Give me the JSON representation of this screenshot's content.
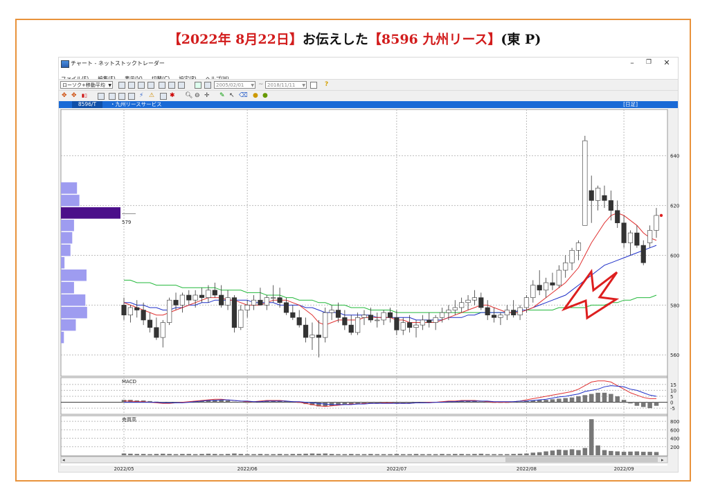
{
  "headline": {
    "date": "【2022年  8月22日】",
    "middle": "お伝えした",
    "stock": "【8596  九州リース】",
    "market": "(東 P)"
  },
  "window": {
    "title": "チャート - ネットストックトレーダー",
    "menu": [
      "ファイル(F)",
      "編集(E)",
      "表示(V)",
      "切替(C)",
      "設定(P)",
      "ヘルプ(H)"
    ],
    "chart_type_select": "ローソク+移動平均",
    "date_from": "2005/02/01",
    "date_to": "2018/11/11",
    "symbol_code": "8596/T",
    "symbol_name": "・九州リースサービス",
    "period": "[日足]",
    "colors": {
      "bluebar": "#1a6ad6",
      "frame": "#e8923a",
      "headline_red": "#d21c1c"
    }
  },
  "chart_data": {
    "type": "candlestick",
    "x_labels": [
      "2022/05",
      "2022/06",
      "2022/07",
      "2022/08",
      "2022/09"
    ],
    "price_axis": {
      "ticks": [
        560,
        580,
        600,
        620,
        640
      ],
      "ylim": [
        552,
        658
      ]
    },
    "volume_profile_label": "579",
    "candles": [
      [
        580,
        583,
        574,
        576
      ],
      [
        576,
        580,
        573,
        579
      ],
      [
        579,
        582,
        575,
        578
      ],
      [
        578,
        581,
        572,
        574
      ],
      [
        574,
        577,
        569,
        571
      ],
      [
        571,
        575,
        566,
        567
      ],
      [
        567,
        574,
        563,
        573
      ],
      [
        573,
        583,
        572,
        582
      ],
      [
        582,
        585,
        578,
        580
      ],
      [
        580,
        585,
        577,
        584
      ],
      [
        584,
        586,
        580,
        582
      ],
      [
        582,
        586,
        579,
        584
      ],
      [
        584,
        587,
        581,
        583
      ],
      [
        583,
        588,
        581,
        586
      ],
      [
        586,
        589,
        583,
        584
      ],
      [
        584,
        588,
        579,
        580
      ],
      [
        580,
        586,
        578,
        583
      ],
      [
        583,
        584,
        569,
        571
      ],
      [
        571,
        580,
        570,
        578
      ],
      [
        578,
        582,
        575,
        580
      ],
      [
        580,
        584,
        578,
        582
      ],
      [
        582,
        587,
        580,
        580
      ],
      [
        580,
        584,
        578,
        583
      ],
      [
        583,
        588,
        581,
        583
      ],
      [
        583,
        587,
        579,
        581
      ],
      [
        581,
        583,
        576,
        577
      ],
      [
        577,
        580,
        574,
        575
      ],
      [
        575,
        578,
        571,
        572
      ],
      [
        572,
        575,
        565,
        567
      ],
      [
        567,
        573,
        562,
        568
      ],
      [
        568,
        574,
        559,
        567
      ],
      [
        567,
        579,
        565,
        577
      ],
      [
        577,
        580,
        574,
        578
      ],
      [
        578,
        581,
        573,
        575
      ],
      [
        575,
        578,
        570,
        572
      ],
      [
        572,
        576,
        568,
        569
      ],
      [
        569,
        577,
        568,
        575
      ],
      [
        575,
        578,
        572,
        576
      ],
      [
        576,
        579,
        573,
        574
      ],
      [
        574,
        577,
        571,
        574
      ],
      [
        574,
        578,
        572,
        577
      ],
      [
        577,
        579,
        573,
        575
      ],
      [
        575,
        578,
        568,
        570
      ],
      [
        570,
        575,
        568,
        573
      ],
      [
        573,
        576,
        569,
        571
      ],
      [
        571,
        574,
        567,
        572
      ],
      [
        572,
        576,
        570,
        574
      ],
      [
        574,
        577,
        571,
        573
      ],
      [
        573,
        576,
        570,
        575
      ],
      [
        575,
        579,
        573,
        577
      ],
      [
        577,
        580,
        574,
        578
      ],
      [
        578,
        582,
        576,
        579
      ],
      [
        579,
        583,
        577,
        581
      ],
      [
        581,
        584,
        578,
        582
      ],
      [
        582,
        586,
        580,
        583
      ],
      [
        583,
        585,
        578,
        579
      ],
      [
        579,
        582,
        574,
        576
      ],
      [
        576,
        579,
        573,
        575
      ],
      [
        575,
        577,
        572,
        576
      ],
      [
        576,
        580,
        574,
        578
      ],
      [
        578,
        582,
        575,
        576
      ],
      [
        576,
        580,
        574,
        579
      ],
      [
        579,
        584,
        577,
        583
      ],
      [
        583,
        590,
        581,
        588
      ],
      [
        588,
        594,
        584,
        586
      ],
      [
        586,
        591,
        583,
        589
      ],
      [
        589,
        593,
        586,
        588
      ],
      [
        588,
        596,
        587,
        594
      ],
      [
        594,
        600,
        591,
        597
      ],
      [
        597,
        603,
        594,
        602
      ],
      [
        602,
        606,
        598,
        605
      ],
      [
        612,
        648,
        612,
        646
      ],
      [
        626,
        632,
        613,
        622
      ],
      [
        622,
        628,
        618,
        627
      ],
      [
        624,
        628,
        619,
        622
      ],
      [
        622,
        626,
        614,
        618
      ],
      [
        618,
        622,
        611,
        613
      ],
      [
        613,
        616,
        603,
        605
      ],
      [
        605,
        610,
        600,
        609
      ],
      [
        609,
        612,
        603,
        604
      ],
      [
        604,
        606,
        596,
        597
      ],
      [
        605,
        612,
        603,
        610
      ],
      [
        610,
        619,
        607,
        616
      ]
    ],
    "ma_short": [
      581,
      580,
      579,
      578,
      577,
      576,
      576,
      577,
      578,
      579,
      580,
      581,
      582,
      583,
      583,
      583,
      582,
      582,
      581,
      580,
      580,
      580,
      581,
      582,
      582,
      582,
      581,
      580,
      578,
      576,
      573,
      572,
      573,
      574,
      574,
      574,
      574,
      575,
      575,
      575,
      575,
      575,
      574,
      574,
      573,
      573,
      573,
      573,
      573,
      574,
      575,
      576,
      577,
      578,
      579,
      580,
      580,
      579,
      578,
      577,
      577,
      577,
      578,
      579,
      581,
      583,
      585,
      587,
      589,
      592,
      595,
      600,
      605,
      609,
      613,
      616,
      617,
      616,
      614,
      612,
      609,
      607,
      606
    ],
    "ma_mid": [
      581,
      581,
      580,
      580,
      579,
      579,
      578,
      578,
      579,
      579,
      580,
      580,
      581,
      581,
      582,
      582,
      582,
      582,
      582,
      582,
      581,
      581,
      581,
      581,
      580,
      580,
      580,
      580,
      579,
      579,
      578,
      577,
      577,
      577,
      576,
      576,
      576,
      576,
      576,
      575,
      575,
      575,
      575,
      575,
      575,
      574,
      574,
      574,
      574,
      574,
      575,
      575,
      575,
      576,
      576,
      577,
      577,
      577,
      577,
      577,
      577,
      578,
      578,
      579,
      580,
      581,
      582,
      583,
      584,
      586,
      588,
      590,
      592,
      594,
      596,
      597,
      598,
      599,
      600,
      601,
      602,
      603,
      604
    ],
    "ma_long": [
      590,
      590,
      589,
      589,
      589,
      588,
      588,
      588,
      588,
      587,
      587,
      587,
      587,
      587,
      587,
      586,
      586,
      586,
      586,
      585,
      585,
      585,
      584,
      584,
      584,
      583,
      583,
      582,
      582,
      582,
      581,
      581,
      580,
      580,
      580,
      579,
      579,
      579,
      578,
      578,
      578,
      578,
      577,
      577,
      577,
      577,
      577,
      577,
      577,
      577,
      577,
      577,
      577,
      577,
      577,
      577,
      577,
      577,
      577,
      577,
      577,
      578,
      578,
      578,
      578,
      578,
      578,
      579,
      579,
      579,
      579,
      579,
      580,
      580,
      580,
      581,
      581,
      582,
      582,
      583,
      583,
      583,
      584
    ],
    "volume_profile": [
      {
        "price": 627,
        "value": 0.27
      },
      {
        "price": 622,
        "value": 0.31
      },
      {
        "price": 617,
        "value": 1.0
      },
      {
        "price": 612,
        "value": 0.22
      },
      {
        "price": 607,
        "value": 0.19
      },
      {
        "price": 602,
        "value": 0.16
      },
      {
        "price": 597,
        "value": 0.06
      },
      {
        "price": 592,
        "value": 0.43
      },
      {
        "price": 587,
        "value": 0.22
      },
      {
        "price": 582,
        "value": 0.41
      },
      {
        "price": 577,
        "value": 0.44
      },
      {
        "price": 572,
        "value": 0.25
      },
      {
        "price": 567,
        "value": 0.05
      }
    ],
    "macd": {
      "label": "MACD",
      "ticks": [
        15,
        10,
        5,
        0,
        -5
      ],
      "ylim": [
        -9,
        19
      ],
      "histogram": [
        2,
        2,
        1.5,
        1.5,
        1,
        0.5,
        -0.5,
        -1,
        -0.5,
        0,
        0.5,
        1,
        1.5,
        2,
        2,
        2,
        1.5,
        0.5,
        0,
        -0.5,
        0,
        0.5,
        1,
        1.5,
        1.5,
        1,
        0.5,
        -0.5,
        -1.5,
        -2.5,
        -3.5,
        -3.5,
        -3,
        -2.5,
        -2,
        -1.5,
        -1.5,
        -1,
        -1,
        -1,
        -0.5,
        -0.5,
        -1,
        -1,
        -1,
        -0.5,
        -0.5,
        -0.5,
        0,
        0,
        0.5,
        0.5,
        1,
        1,
        1,
        0.5,
        0,
        -0.5,
        -0.5,
        -0.5,
        0,
        0.5,
        1,
        1.5,
        2,
        2,
        2.5,
        3,
        3.5,
        4,
        5,
        6,
        7,
        8,
        8,
        7,
        5,
        2,
        -1,
        -3,
        -4,
        -5,
        -3
      ],
      "macd_line": [
        1,
        1,
        0.5,
        0.5,
        0,
        -0.5,
        -1,
        -1,
        -0.5,
        0,
        0.5,
        1,
        1.5,
        2,
        2.5,
        2.5,
        2,
        1.5,
        1,
        0.5,
        0.5,
        1,
        1.5,
        1.5,
        1.5,
        1,
        0.5,
        0,
        -1,
        -2,
        -3,
        -3.5,
        -3,
        -2.5,
        -2,
        -1.5,
        -1.5,
        -1,
        -1,
        -1,
        -0.5,
        -0.5,
        -1,
        -1,
        -1,
        -0.5,
        -0.5,
        0,
        0,
        0.5,
        1,
        1,
        1.5,
        1.5,
        1.5,
        1,
        0.5,
        0,
        0,
        0,
        0.5,
        1,
        2,
        3,
        4,
        5,
        6,
        7,
        8,
        9,
        11,
        14,
        17,
        18,
        18,
        17,
        14,
        11,
        8,
        6,
        4,
        3,
        3
      ],
      "signal_line": [
        0,
        0,
        0,
        0,
        0,
        0,
        -0.5,
        -0.5,
        -0.5,
        -0.5,
        0,
        0.5,
        1,
        1.5,
        1.5,
        2,
        2,
        1.5,
        1,
        1,
        0.5,
        0.5,
        1,
        1,
        1,
        1,
        0.5,
        0.5,
        0,
        -0.5,
        -1,
        -1.5,
        -2,
        -2,
        -2,
        -2,
        -1.5,
        -1.5,
        -1,
        -1,
        -1,
        -1,
        -1,
        -1,
        -1,
        -0.5,
        -0.5,
        -0.5,
        0,
        0,
        0.5,
        0.5,
        1,
        1,
        1,
        1,
        1,
        0.5,
        0.5,
        0.5,
        0.5,
        1,
        1,
        1.5,
        2,
        2.5,
        3.5,
        4.5,
        5,
        6,
        7,
        9,
        10,
        11,
        13,
        14,
        13.5,
        13,
        11,
        10,
        8,
        6,
        5
      ]
    },
    "volume": {
      "label": "売買高",
      "ticks": [
        800,
        600,
        400,
        200
      ],
      "ylim": [
        0,
        900
      ],
      "values": [
        40,
        35,
        30,
        30,
        25,
        30,
        35,
        30,
        25,
        30,
        30,
        25,
        30,
        35,
        30,
        25,
        30,
        40,
        30,
        25,
        25,
        30,
        25,
        25,
        30,
        25,
        30,
        30,
        35,
        40,
        35,
        40,
        30,
        25,
        25,
        30,
        25,
        25,
        30,
        25,
        25,
        25,
        30,
        25,
        25,
        30,
        25,
        25,
        25,
        30,
        25,
        30,
        30,
        25,
        30,
        35,
        25,
        25,
        25,
        25,
        30,
        35,
        40,
        60,
        70,
        90,
        110,
        130,
        120,
        140,
        120,
        170,
        850,
        230,
        120,
        100,
        90,
        80,
        85,
        90,
        80,
        80,
        75
      ]
    },
    "annotation": "red arrow pointing to breakout"
  }
}
